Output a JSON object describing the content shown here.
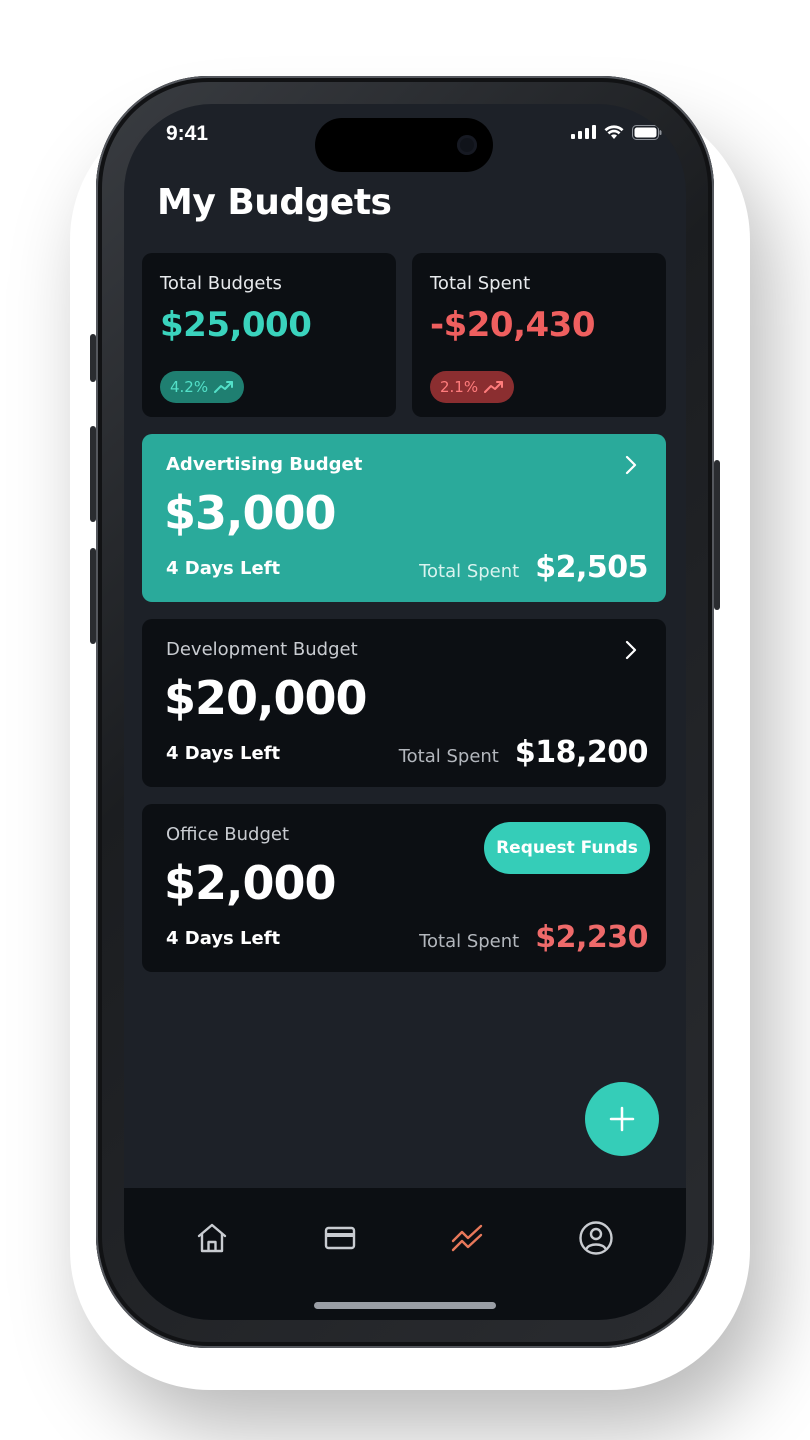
{
  "status_bar": {
    "time": "9:41"
  },
  "header": {
    "title": "My Budgets"
  },
  "summary": {
    "total_budgets": {
      "label": "Total Budgets",
      "amount": "$25,000",
      "change": "4.2%",
      "trend_icon": "trend-up-icon"
    },
    "total_spent": {
      "label": "Total Spent",
      "amount": "-$20,430",
      "change": "2.1%",
      "trend_icon": "trend-up-icon"
    }
  },
  "budgets": [
    {
      "name": "Advertising Budget",
      "amount": "$3,000",
      "days_left": "4 Days Left",
      "spent_label": "Total Spent",
      "spent": "$2,505",
      "action_icon": "chevron-right-icon"
    },
    {
      "name": "Development Budget",
      "amount": "$20,000",
      "days_left": "4 Days Left",
      "spent_label": "Total Spent",
      "spent": "$18,200",
      "action_icon": "chevron-right-icon"
    },
    {
      "name": "Office Budget",
      "amount": "$2,000",
      "days_left": "4 Days Left",
      "spent_label": "Total Spent",
      "spent": "$2,230",
      "action_label": "Request Funds"
    }
  ],
  "fab": {
    "icon": "plus-icon"
  },
  "bottom_nav": {
    "items": [
      {
        "icon": "home-icon",
        "active": false
      },
      {
        "icon": "card-icon",
        "active": false
      },
      {
        "icon": "analytics-icon",
        "active": true
      },
      {
        "icon": "profile-icon",
        "active": false
      }
    ]
  },
  "colors": {
    "background": "#1d2128",
    "card": "#0c0f13",
    "accent_teal": "#35cdb8",
    "active_card": "#2aaa9b",
    "negative_red": "#ef5f5f",
    "nav_active": "#e8785a",
    "nav_inactive": "#c9ccd1"
  }
}
